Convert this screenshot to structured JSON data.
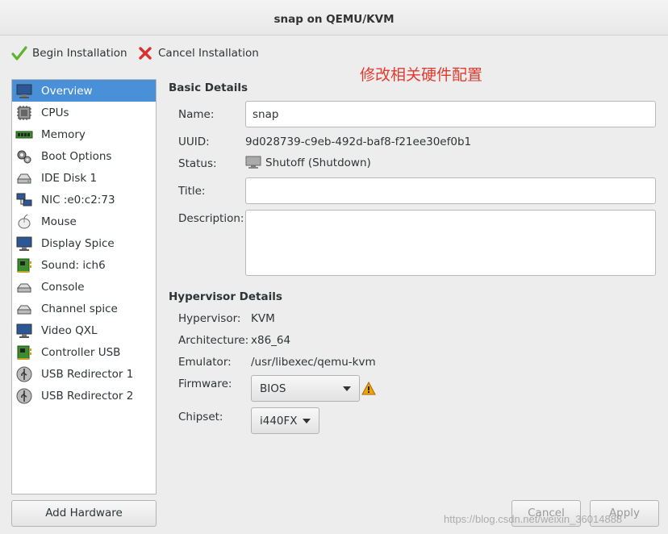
{
  "window": {
    "title": "snap on QEMU/KVM"
  },
  "toolbar": {
    "begin_label": "Begin Installation",
    "cancel_label": "Cancel Installation"
  },
  "annotation": "修改相关硬件配置",
  "sidebar": {
    "items": [
      {
        "label": "Overview",
        "icon": "monitor-icon"
      },
      {
        "label": "CPUs",
        "icon": "cpu-icon"
      },
      {
        "label": "Memory",
        "icon": "memory-icon"
      },
      {
        "label": "Boot Options",
        "icon": "gear-icon"
      },
      {
        "label": "IDE Disk 1",
        "icon": "disk-icon"
      },
      {
        "label": "NIC :e0:c2:73",
        "icon": "network-icon"
      },
      {
        "label": "Mouse",
        "icon": "mouse-icon"
      },
      {
        "label": "Display Spice",
        "icon": "display-icon"
      },
      {
        "label": "Sound: ich6",
        "icon": "sound-card-icon"
      },
      {
        "label": "Console",
        "icon": "console-icon"
      },
      {
        "label": "Channel spice",
        "icon": "channel-icon"
      },
      {
        "label": "Video QXL",
        "icon": "video-icon"
      },
      {
        "label": "Controller USB",
        "icon": "controller-icon"
      },
      {
        "label": "USB Redirector 1",
        "icon": "usb-icon"
      },
      {
        "label": "USB Redirector 2",
        "icon": "usb-icon"
      }
    ],
    "add_hardware_label": "Add Hardware"
  },
  "basic": {
    "section_title": "Basic Details",
    "name_label": "Name:",
    "name_value": "snap",
    "uuid_label": "UUID:",
    "uuid_value": "9d028739-c9eb-492d-baf8-f21ee30ef0b1",
    "status_label": "Status:",
    "status_value": "Shutoff (Shutdown)",
    "title_label": "Title:",
    "title_value": "",
    "description_label": "Description:",
    "description_value": ""
  },
  "hypervisor": {
    "section_title": "Hypervisor Details",
    "hypervisor_label": "Hypervisor:",
    "hypervisor_value": "KVM",
    "architecture_label": "Architecture:",
    "architecture_value": "x86_64",
    "emulator_label": "Emulator:",
    "emulator_value": "/usr/libexec/qemu-kvm",
    "firmware_label": "Firmware:",
    "firmware_value": "BIOS",
    "chipset_label": "Chipset:",
    "chipset_value": "i440FX"
  },
  "buttons": {
    "cancel_label": "Cancel",
    "apply_label": "Apply"
  },
  "watermark": "https://blog.csdn.net/weixin_36014888",
  "colors": {
    "selection": "#4a90d9",
    "annotation": "#e33a2e",
    "warning": "#f0a30a"
  }
}
